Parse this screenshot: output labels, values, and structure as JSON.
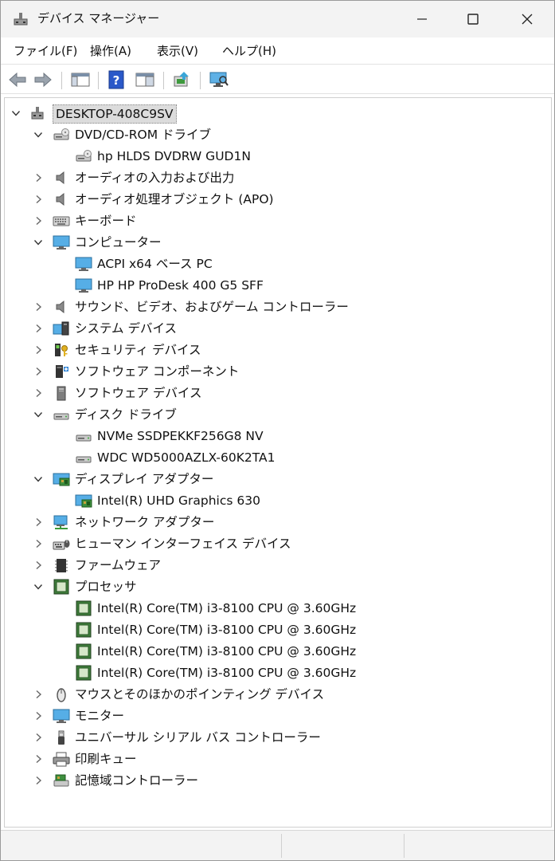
{
  "window": {
    "title": "デバイス マネージャー",
    "icon": "device-manager-icon"
  },
  "menu": [
    "ファイル(F)",
    "操作(A)",
    "表示(V)",
    "ヘルプ(H)"
  ],
  "toolbar": [
    {
      "name": "back-icon"
    },
    {
      "name": "forward-icon"
    },
    {
      "name": "show-hide-console-tree-icon"
    },
    {
      "name": "help-icon"
    },
    {
      "name": "properties-pane-icon"
    },
    {
      "name": "update-driver-icon"
    },
    {
      "name": "scan-hardware-icon"
    }
  ],
  "tree": [
    {
      "label": "DESKTOP-408C9SV",
      "level": 0,
      "state": "expanded",
      "icon": "computer-network-icon",
      "selected": true
    },
    {
      "label": "DVD/CD-ROM ドライブ",
      "level": 1,
      "state": "expanded",
      "icon": "dvd-drive-icon"
    },
    {
      "label": "hp HLDS DVDRW  GUD1N",
      "level": 2,
      "state": "leaf",
      "icon": "dvd-drive-icon"
    },
    {
      "label": "オーディオの入力および出力",
      "level": 1,
      "state": "collapsed",
      "icon": "speaker-icon"
    },
    {
      "label": "オーディオ処理オブジェクト (APO)",
      "level": 1,
      "state": "collapsed",
      "icon": "speaker-icon"
    },
    {
      "label": "キーボード",
      "level": 1,
      "state": "collapsed",
      "icon": "keyboard-icon"
    },
    {
      "label": "コンピューター",
      "level": 1,
      "state": "expanded",
      "icon": "monitor-icon"
    },
    {
      "label": "ACPI x64 ベース PC",
      "level": 2,
      "state": "leaf",
      "icon": "monitor-icon"
    },
    {
      "label": "HP HP ProDesk 400 G5 SFF",
      "level": 2,
      "state": "leaf",
      "icon": "monitor-icon"
    },
    {
      "label": "サウンド、ビデオ、およびゲーム コントローラー",
      "level": 1,
      "state": "collapsed",
      "icon": "speaker-icon"
    },
    {
      "label": "システム デバイス",
      "level": 1,
      "state": "collapsed",
      "icon": "system-devices-icon"
    },
    {
      "label": "セキュリティ デバイス",
      "level": 1,
      "state": "collapsed",
      "icon": "security-key-icon"
    },
    {
      "label": "ソフトウェア コンポーネント",
      "level": 1,
      "state": "collapsed",
      "icon": "software-component-icon"
    },
    {
      "label": "ソフトウェア デバイス",
      "level": 1,
      "state": "collapsed",
      "icon": "software-device-icon"
    },
    {
      "label": "ディスク ドライブ",
      "level": 1,
      "state": "expanded",
      "icon": "disk-drive-icon"
    },
    {
      "label": "NVMe SSDPEKKF256G8 NV",
      "level": 2,
      "state": "leaf",
      "icon": "disk-drive-icon"
    },
    {
      "label": "WDC WD5000AZLX-60K2TA1",
      "level": 2,
      "state": "leaf",
      "icon": "disk-drive-icon"
    },
    {
      "label": "ディスプレイ アダプター",
      "level": 1,
      "state": "expanded",
      "icon": "display-adapter-icon"
    },
    {
      "label": "Intel(R) UHD Graphics 630",
      "level": 2,
      "state": "leaf",
      "icon": "display-adapter-icon"
    },
    {
      "label": "ネットワーク アダプター",
      "level": 1,
      "state": "collapsed",
      "icon": "network-adapter-icon"
    },
    {
      "label": "ヒューマン インターフェイス デバイス",
      "level": 1,
      "state": "collapsed",
      "icon": "hid-icon"
    },
    {
      "label": "ファームウェア",
      "level": 1,
      "state": "collapsed",
      "icon": "firmware-icon"
    },
    {
      "label": "プロセッサ",
      "level": 1,
      "state": "expanded",
      "icon": "processor-icon"
    },
    {
      "label": "Intel(R) Core(TM) i3-8100 CPU @ 3.60GHz",
      "level": 2,
      "state": "leaf",
      "icon": "processor-icon"
    },
    {
      "label": "Intel(R) Core(TM) i3-8100 CPU @ 3.60GHz",
      "level": 2,
      "state": "leaf",
      "icon": "processor-icon"
    },
    {
      "label": "Intel(R) Core(TM) i3-8100 CPU @ 3.60GHz",
      "level": 2,
      "state": "leaf",
      "icon": "processor-icon"
    },
    {
      "label": "Intel(R) Core(TM) i3-8100 CPU @ 3.60GHz",
      "level": 2,
      "state": "leaf",
      "icon": "processor-icon"
    },
    {
      "label": "マウスとそのほかのポインティング デバイス",
      "level": 1,
      "state": "collapsed",
      "icon": "mouse-icon"
    },
    {
      "label": "モニター",
      "level": 1,
      "state": "collapsed",
      "icon": "monitor-icon"
    },
    {
      "label": "ユニバーサル シリアル バス コントローラー",
      "level": 1,
      "state": "collapsed",
      "icon": "usb-icon"
    },
    {
      "label": "印刷キュー",
      "level": 1,
      "state": "collapsed",
      "icon": "printer-icon"
    },
    {
      "label": "記憶域コントローラー",
      "level": 1,
      "state": "collapsed",
      "icon": "storage-controller-icon"
    }
  ]
}
